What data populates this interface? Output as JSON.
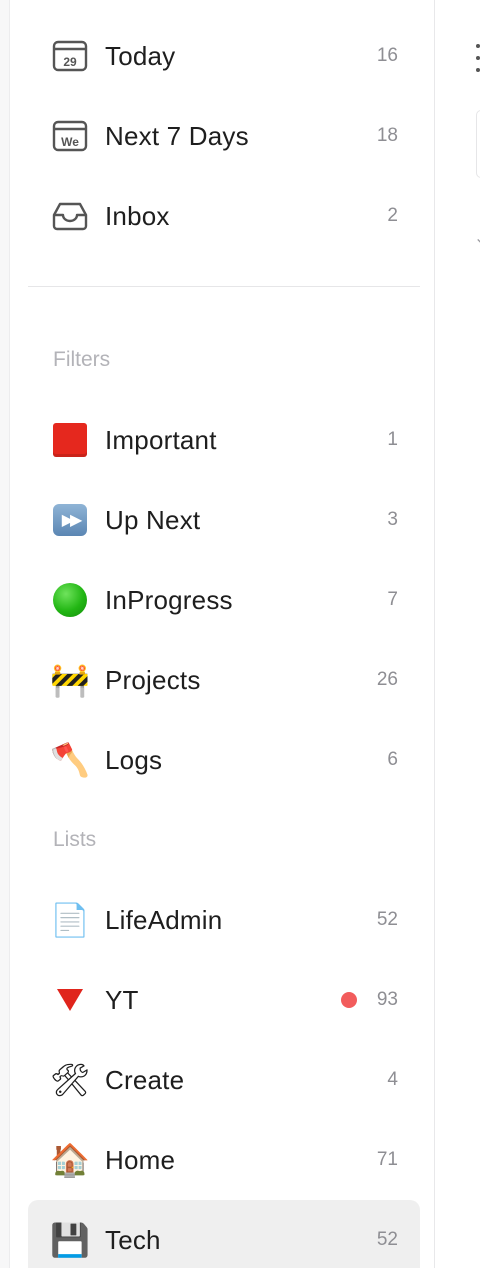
{
  "smart_lists": [
    {
      "label": "Today",
      "count": "16",
      "icon": "calendar-29-icon",
      "icon_text": "29"
    },
    {
      "label": "Next 7 Days",
      "count": "18",
      "icon": "calendar-week-icon",
      "icon_text": "We"
    },
    {
      "label": "Inbox",
      "count": "2",
      "icon": "inbox-tray-icon"
    }
  ],
  "filters": {
    "title": "Filters",
    "items": [
      {
        "label": "Important",
        "count": "1",
        "icon": "red-square-icon"
      },
      {
        "label": "Up Next",
        "count": "3",
        "icon": "fast-forward-icon",
        "glyph": "▶▶"
      },
      {
        "label": "InProgress",
        "count": "7",
        "icon": "green-circle-icon"
      },
      {
        "label": "Projects",
        "count": "26",
        "icon": "construction-barrier-icon",
        "glyph": "🚧"
      },
      {
        "label": "Logs",
        "count": "6",
        "icon": "axe-icon",
        "glyph": "🪓"
      }
    ]
  },
  "lists": {
    "title": "Lists",
    "items": [
      {
        "label": "LifeAdmin",
        "count": "52",
        "icon": "document-icon",
        "glyph": "📄"
      },
      {
        "label": "YT",
        "count": "93",
        "icon": "red-triangle-down-icon",
        "has_dot": true,
        "dot_color": "#f25c5c"
      },
      {
        "label": "Create",
        "count": "4",
        "icon": "hammer-wrench-icon",
        "glyph": "🛠"
      },
      {
        "label": "Home",
        "count": "71",
        "icon": "house-icon",
        "glyph": "🏠"
      },
      {
        "label": "Tech",
        "count": "52",
        "icon": "floppy-disk-icon",
        "glyph": "💾",
        "selected": true
      }
    ]
  },
  "colors": {
    "selected_bg": "#efefef",
    "count_text": "#8e8e93",
    "section_title": "#b3b3b8"
  }
}
